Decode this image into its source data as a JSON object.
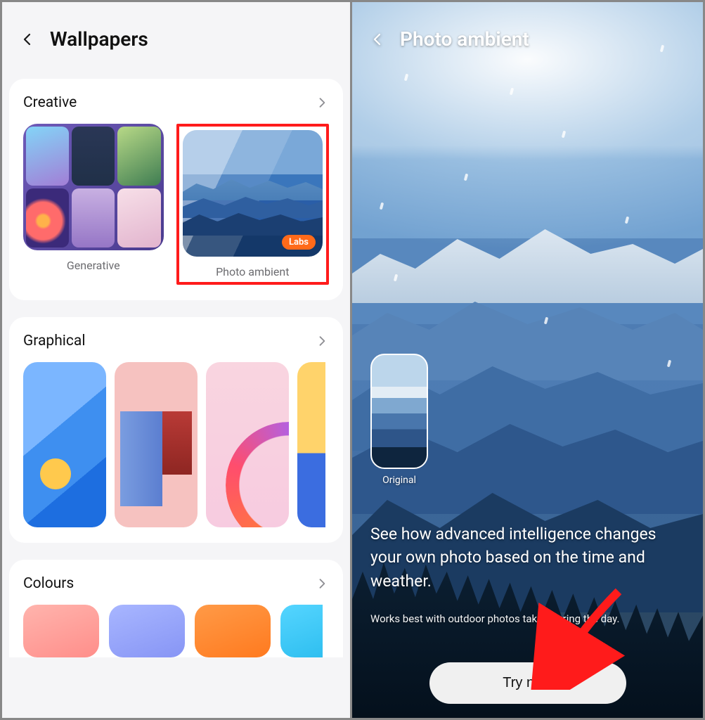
{
  "left": {
    "header_title": "Wallpapers",
    "sections": {
      "creative": {
        "title": "Creative",
        "items": [
          {
            "label": "Generative"
          },
          {
            "label": "Photo ambient",
            "badge": "Labs"
          }
        ]
      },
      "graphical": {
        "title": "Graphical"
      },
      "colours": {
        "title": "Colours"
      }
    }
  },
  "right": {
    "header_title": "Photo ambient",
    "original_label": "Original",
    "description": "See how advanced intelligence changes your own photo based on the time and weather.",
    "note": "Works best with outdoor photos taken during the day.",
    "cta": "Try now"
  }
}
